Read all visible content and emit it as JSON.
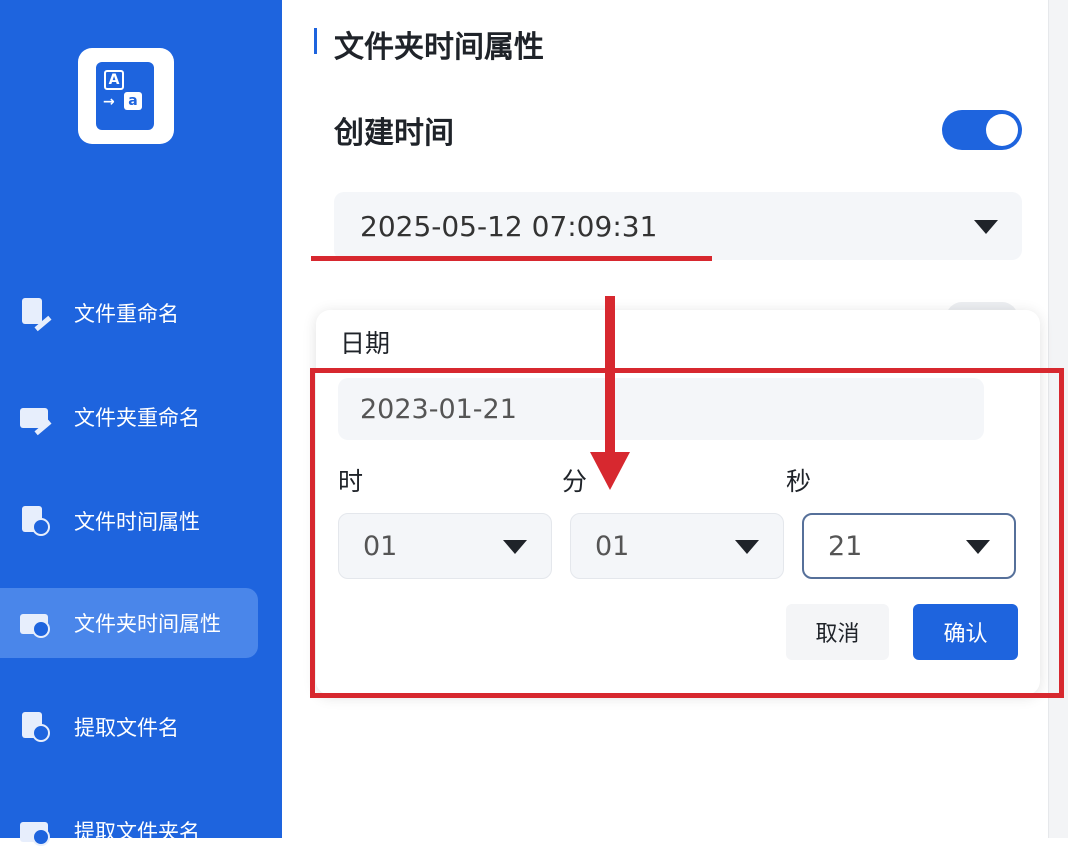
{
  "sidebar": {
    "logo_glyph_a": "A",
    "logo_glyph_arrow": "→",
    "logo_glyph_b": "a",
    "items": [
      {
        "label": "文件重命名",
        "icon": "file-edit-icon",
        "active": false
      },
      {
        "label": "文件夹重命名",
        "icon": "folder-edit-icon",
        "active": false
      },
      {
        "label": "文件时间属性",
        "icon": "file-clock-icon",
        "active": false
      },
      {
        "label": "文件夹时间属性",
        "icon": "folder-clock-icon",
        "active": true
      },
      {
        "label": "提取文件名",
        "icon": "file-extract-icon",
        "active": false
      },
      {
        "label": "提取文件夹名",
        "icon": "folder-extract-icon",
        "active": false
      }
    ]
  },
  "main": {
    "section_title": "文件夹时间属性",
    "create_time": {
      "label": "创建时间",
      "enabled": true,
      "value": "2025-05-12 07:09:31"
    }
  },
  "picker": {
    "date_label": "日期",
    "date_value": "2023-01-21",
    "hour_label": "时",
    "minute_label": "分",
    "second_label": "秒",
    "hour_value": "01",
    "minute_value": "01",
    "second_value": "21",
    "cancel_label": "取消",
    "confirm_label": "确认"
  },
  "colors": {
    "brand_blue": "#1e64de",
    "annotation_red": "#d7282f"
  }
}
